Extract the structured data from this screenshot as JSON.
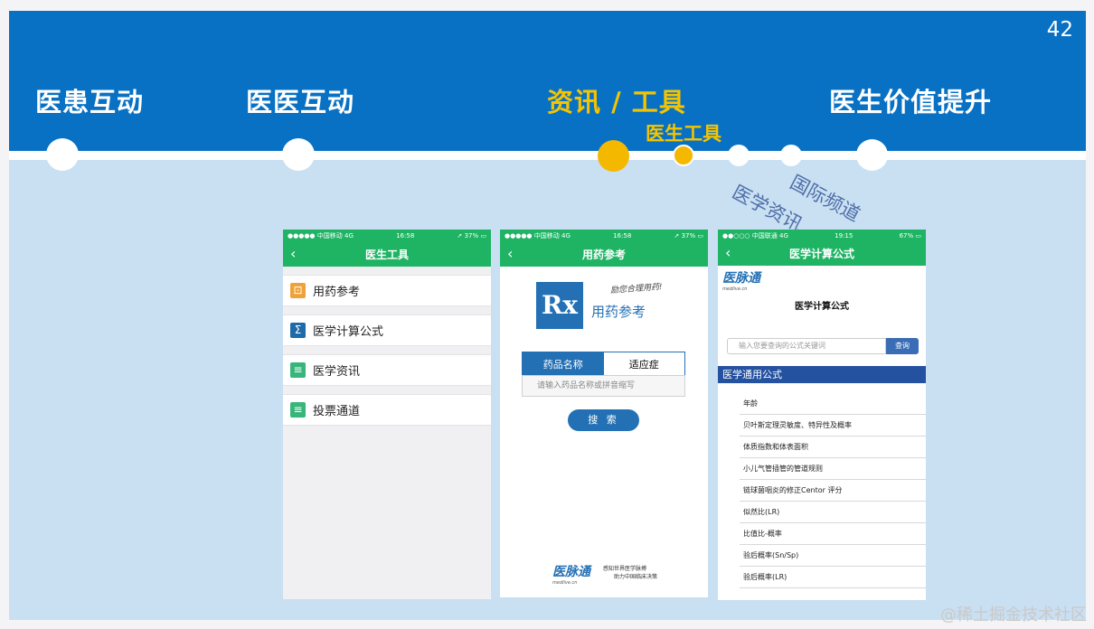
{
  "slide": {
    "page_number": "42",
    "stages": [
      "医患互动",
      "医医互动",
      "资讯 / 工具",
      "医生价值提升"
    ],
    "sub_stage": "医生工具",
    "tags": [
      "医学资讯",
      "国际频道"
    ],
    "colors": {
      "band": "#0971c4",
      "background": "#c9dff2",
      "highlight": "#f5c400"
    }
  },
  "phone1": {
    "status": {
      "carrier": "●●●●● 中国移动  4G",
      "time": "16:58",
      "battery": "➚ 37% ▭"
    },
    "back_icon": "chevron-left-icon",
    "title": "医生工具",
    "items": [
      {
        "label": "用药参考",
        "icon": "medicine-icon",
        "color": "#f0a23a"
      },
      {
        "label": "医学计算公式",
        "icon": "sigma-icon",
        "color": "#1f6aa8"
      },
      {
        "label": "医学资讯",
        "icon": "document-icon",
        "color": "#38b57a"
      },
      {
        "label": "投票通道",
        "icon": "document-icon",
        "color": "#38b57a"
      }
    ]
  },
  "phone2": {
    "status": {
      "carrier": "●●●●● 中国移动  4G",
      "time": "16:58",
      "battery": "➚ 37% ▭"
    },
    "title": "用药参考",
    "logo_text": "Rx",
    "app_name": "用药参考",
    "slogan": "励您合理用药!",
    "tabs": [
      "药品名称",
      "适应症"
    ],
    "placeholder": "请输入药品名称或拼音缩写",
    "search_label": "搜 索",
    "brand": "医脉通",
    "brand_url": "medlive.cn",
    "brand_slogan_1": "感知世界医学脉搏",
    "brand_slogan_2": "助力中国临床决策"
  },
  "phone3": {
    "status": {
      "carrier": "●●○○○ 中国联通  4G",
      "time": "19:15",
      "battery": "67% ▭"
    },
    "title": "医学计算公式",
    "brand": "医脉通",
    "brand_url": "medlive.cn",
    "page_title": "医学计算公式",
    "placeholder": "输入您要查询的公式关键词",
    "search_label": "查询",
    "section": "医学通用公式",
    "formulas": [
      "年龄",
      "贝叶斯定理灵敏度、特异性及概率",
      "体质指数和体表面积",
      "小儿气管插管的管道规则",
      "链球菌咽炎的修正Centor 评分",
      "似然比(LR)",
      "比值比-概率",
      "验后概率(Sn/Sp)",
      "验后概率(LR)"
    ]
  },
  "watermark": "@稀土掘金技术社区"
}
